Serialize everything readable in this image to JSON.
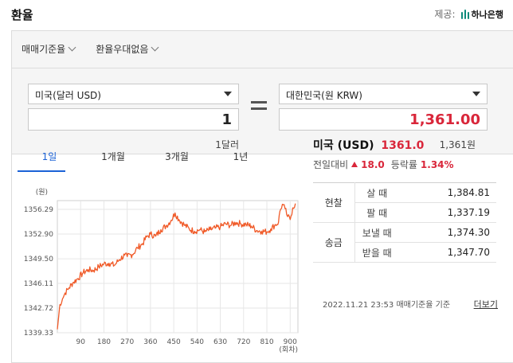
{
  "title": "환율",
  "provider": {
    "label": "제공:",
    "name": "하나은행"
  },
  "options": [
    {
      "label": "매매기준율"
    },
    {
      "label": "환율우대없음"
    }
  ],
  "from": {
    "currency": "미국(달러 USD)",
    "amount": "1",
    "sub": "1달러"
  },
  "to": {
    "currency": "대한민국(원 KRW)",
    "amount": "1,361.00",
    "sub": "1,361원"
  },
  "tabs": [
    "1일",
    "1개월",
    "3개월",
    "1년"
  ],
  "active_tab": 0,
  "summary": {
    "country": "미국 (USD)",
    "rate": "1361.0",
    "change_label": "전일대비",
    "change": "18.0",
    "rise_label": "등락률",
    "rise": "1.34%"
  },
  "rates": [
    {
      "group": "현찰",
      "label": "살 때",
      "value": "1,384.81"
    },
    {
      "group": "",
      "label": "팔 때",
      "value": "1,337.19"
    },
    {
      "group": "송금",
      "label": "보낼 때",
      "value": "1,374.30"
    },
    {
      "group": "",
      "label": "받을 때",
      "value": "1,347.70"
    }
  ],
  "footer": {
    "timestamp": "2022.11.21 23:53",
    "note": "매매기준율 기준",
    "more": "더보기"
  },
  "colors": {
    "accent": "#1b62d6",
    "up": "#d9263a",
    "line": "#f05a28"
  },
  "chart_data": {
    "type": "line",
    "ylabel": "(원)",
    "xlabel": "(회차)",
    "y_ticks": [
      "1356.29",
      "1352.90",
      "1349.50",
      "1346.11",
      "1342.72",
      "1339.33"
    ],
    "x_ticks": [
      "90",
      "180",
      "270",
      "360",
      "450",
      "540",
      "630",
      "720",
      "810",
      "900"
    ],
    "ylim": [
      1339.33,
      1357.5
    ],
    "xlim": [
      0,
      930
    ],
    "grid": true,
    "series": [
      {
        "x": [
          0,
          5,
          10,
          20,
          30,
          45,
          60,
          80,
          100,
          120,
          140,
          160,
          180,
          200,
          220,
          240,
          260,
          270,
          290,
          310,
          330,
          345,
          360,
          380,
          400,
          420,
          440,
          455,
          470,
          490,
          510,
          530,
          550,
          570,
          590,
          610,
          630,
          650,
          670,
          690,
          710,
          730,
          750,
          770,
          790,
          810,
          825,
          840,
          855,
          860,
          870,
          880,
          890,
          900,
          910,
          920
        ],
        "y": [
          1339.8,
          1341.5,
          1343.2,
          1344.0,
          1344.8,
          1345.5,
          1346.2,
          1346.8,
          1347.6,
          1348.0,
          1347.9,
          1348.4,
          1348.8,
          1348.9,
          1348.6,
          1349.4,
          1350.0,
          1349.8,
          1350.1,
          1351.0,
          1351.6,
          1352.5,
          1352.9,
          1352.6,
          1353.5,
          1354.0,
          1354.8,
          1355.8,
          1354.9,
          1354.2,
          1353.6,
          1353.3,
          1353.5,
          1353.2,
          1353.5,
          1353.7,
          1353.9,
          1354.3,
          1354.1,
          1354.5,
          1354.3,
          1354.2,
          1354.0,
          1353.4,
          1353.3,
          1353.2,
          1353.6,
          1354.1,
          1354.5,
          1356.0,
          1357.0,
          1356.4,
          1355.3,
          1354.9,
          1356.5,
          1357.1
        ]
      }
    ]
  }
}
